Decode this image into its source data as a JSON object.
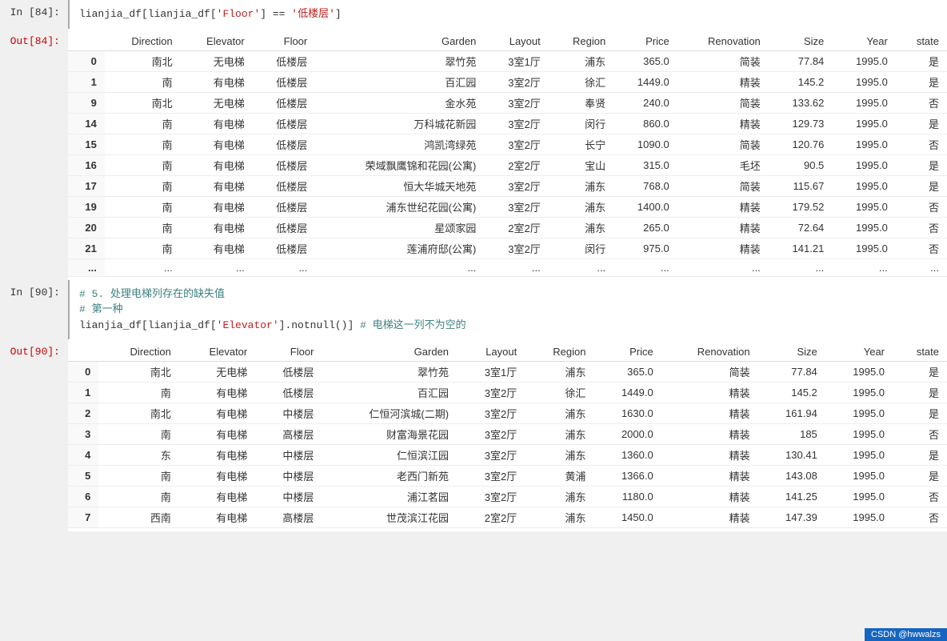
{
  "cells": [
    {
      "type": "input",
      "label": "In  [84]:",
      "code": "lianjia_df[lianjia_df['Floor'] == '低楼层']"
    },
    {
      "type": "output",
      "label": "Out[84]:",
      "table": {
        "columns": [
          "",
          "Direction",
          "Elevator",
          "Floor",
          "Garden",
          "Layout",
          "Region",
          "Price",
          "Renovation",
          "Size",
          "Year",
          "state"
        ],
        "rows": [
          [
            "0",
            "南北",
            "无电梯",
            "低楼层",
            "翠竹苑",
            "3室1厅",
            "浦东",
            "365.0",
            "简装",
            "77.84",
            "1995.0",
            "是"
          ],
          [
            "1",
            "南",
            "有电梯",
            "低楼层",
            "百汇园",
            "3室2厅",
            "徐汇",
            "1449.0",
            "精装",
            "145.2",
            "1995.0",
            "是"
          ],
          [
            "9",
            "南北",
            "无电梯",
            "低楼层",
            "金水苑",
            "3室2厅",
            "奉贤",
            "240.0",
            "简装",
            "133.62",
            "1995.0",
            "否"
          ],
          [
            "14",
            "南",
            "有电梯",
            "低楼层",
            "万科城花新园",
            "3室2厅",
            "闵行",
            "860.0",
            "精装",
            "129.73",
            "1995.0",
            "是"
          ],
          [
            "15",
            "南",
            "有电梯",
            "低楼层",
            "鸿凯湾绿苑",
            "3室2厅",
            "长宁",
            "1090.0",
            "简装",
            "120.76",
            "1995.0",
            "否"
          ],
          [
            "16",
            "南",
            "有电梯",
            "低楼层",
            "荣域飘鹰锦和花园(公寓)",
            "2室2厅",
            "宝山",
            "315.0",
            "毛坯",
            "90.5",
            "1995.0",
            "是"
          ],
          [
            "17",
            "南",
            "有电梯",
            "低楼层",
            "恒大华城天地苑",
            "3室2厅",
            "浦东",
            "768.0",
            "简装",
            "115.67",
            "1995.0",
            "是"
          ],
          [
            "19",
            "南",
            "有电梯",
            "低楼层",
            "浦东世纪花园(公寓)",
            "3室2厅",
            "浦东",
            "1400.0",
            "精装",
            "179.52",
            "1995.0",
            "否"
          ],
          [
            "20",
            "南",
            "有电梯",
            "低楼层",
            "星颂家园",
            "2室2厅",
            "浦东",
            "265.0",
            "精装",
            "72.64",
            "1995.0",
            "否"
          ],
          [
            "21",
            "南",
            "有电梯",
            "低楼层",
            "莲浦府邸(公寓)",
            "3室2厅",
            "闵行",
            "975.0",
            "精装",
            "141.21",
            "1995.0",
            "否"
          ],
          [
            "...",
            "...",
            "...",
            "...",
            "...",
            "...",
            "...",
            "...",
            "...",
            "...",
            "...",
            "..."
          ]
        ]
      }
    },
    {
      "type": "input",
      "label": "In  [90]:",
      "code_lines": [
        "# 5. 处理电梯列存在的缺失值",
        "# 第一种",
        "lianjia_df[lianjia_df['Elevator'].notnull()]  # 电梯这一列不为空的"
      ]
    },
    {
      "type": "output",
      "label": "Out[90]:",
      "table": {
        "columns": [
          "",
          "Direction",
          "Elevator",
          "Floor",
          "Garden",
          "Layout",
          "Region",
          "Price",
          "Renovation",
          "Size",
          "Year",
          "state"
        ],
        "rows": [
          [
            "0",
            "南北",
            "无电梯",
            "低楼层",
            "翠竹苑",
            "3室1厅",
            "浦东",
            "365.0",
            "简装",
            "77.84",
            "1995.0",
            "是"
          ],
          [
            "1",
            "南",
            "有电梯",
            "低楼层",
            "百汇园",
            "3室2厅",
            "徐汇",
            "1449.0",
            "精装",
            "145.2",
            "1995.0",
            "是"
          ],
          [
            "2",
            "南北",
            "有电梯",
            "中楼层",
            "仁恒河滨城(二期)",
            "3室2厅",
            "浦东",
            "1630.0",
            "精装",
            "161.94",
            "1995.0",
            "是"
          ],
          [
            "3",
            "南",
            "有电梯",
            "高楼层",
            "财富海景花园",
            "3室2厅",
            "浦东",
            "2000.0",
            "精装",
            "185",
            "1995.0",
            "否"
          ],
          [
            "4",
            "东",
            "有电梯",
            "中楼层",
            "仁恒滨江园",
            "3室2厅",
            "浦东",
            "1360.0",
            "精装",
            "130.41",
            "1995.0",
            "是"
          ],
          [
            "5",
            "南",
            "有电梯",
            "中楼层",
            "老西门新苑",
            "3室2厅",
            "黄浦",
            "1366.0",
            "精装",
            "143.08",
            "1995.0",
            "是"
          ],
          [
            "6",
            "南",
            "有电梯",
            "中楼层",
            "浦江茗园",
            "3室2厅",
            "浦东",
            "1180.0",
            "精装",
            "141.25",
            "1995.0",
            "否"
          ],
          [
            "7",
            "西南",
            "有电梯",
            "高楼层",
            "世茂滨江花园",
            "2室2厅",
            "浦东",
            "1450.0",
            "精装",
            "147.39",
            "1995.0",
            "否"
          ]
        ]
      }
    }
  ],
  "footer": {
    "text": "CSDN @hwwalzs"
  }
}
